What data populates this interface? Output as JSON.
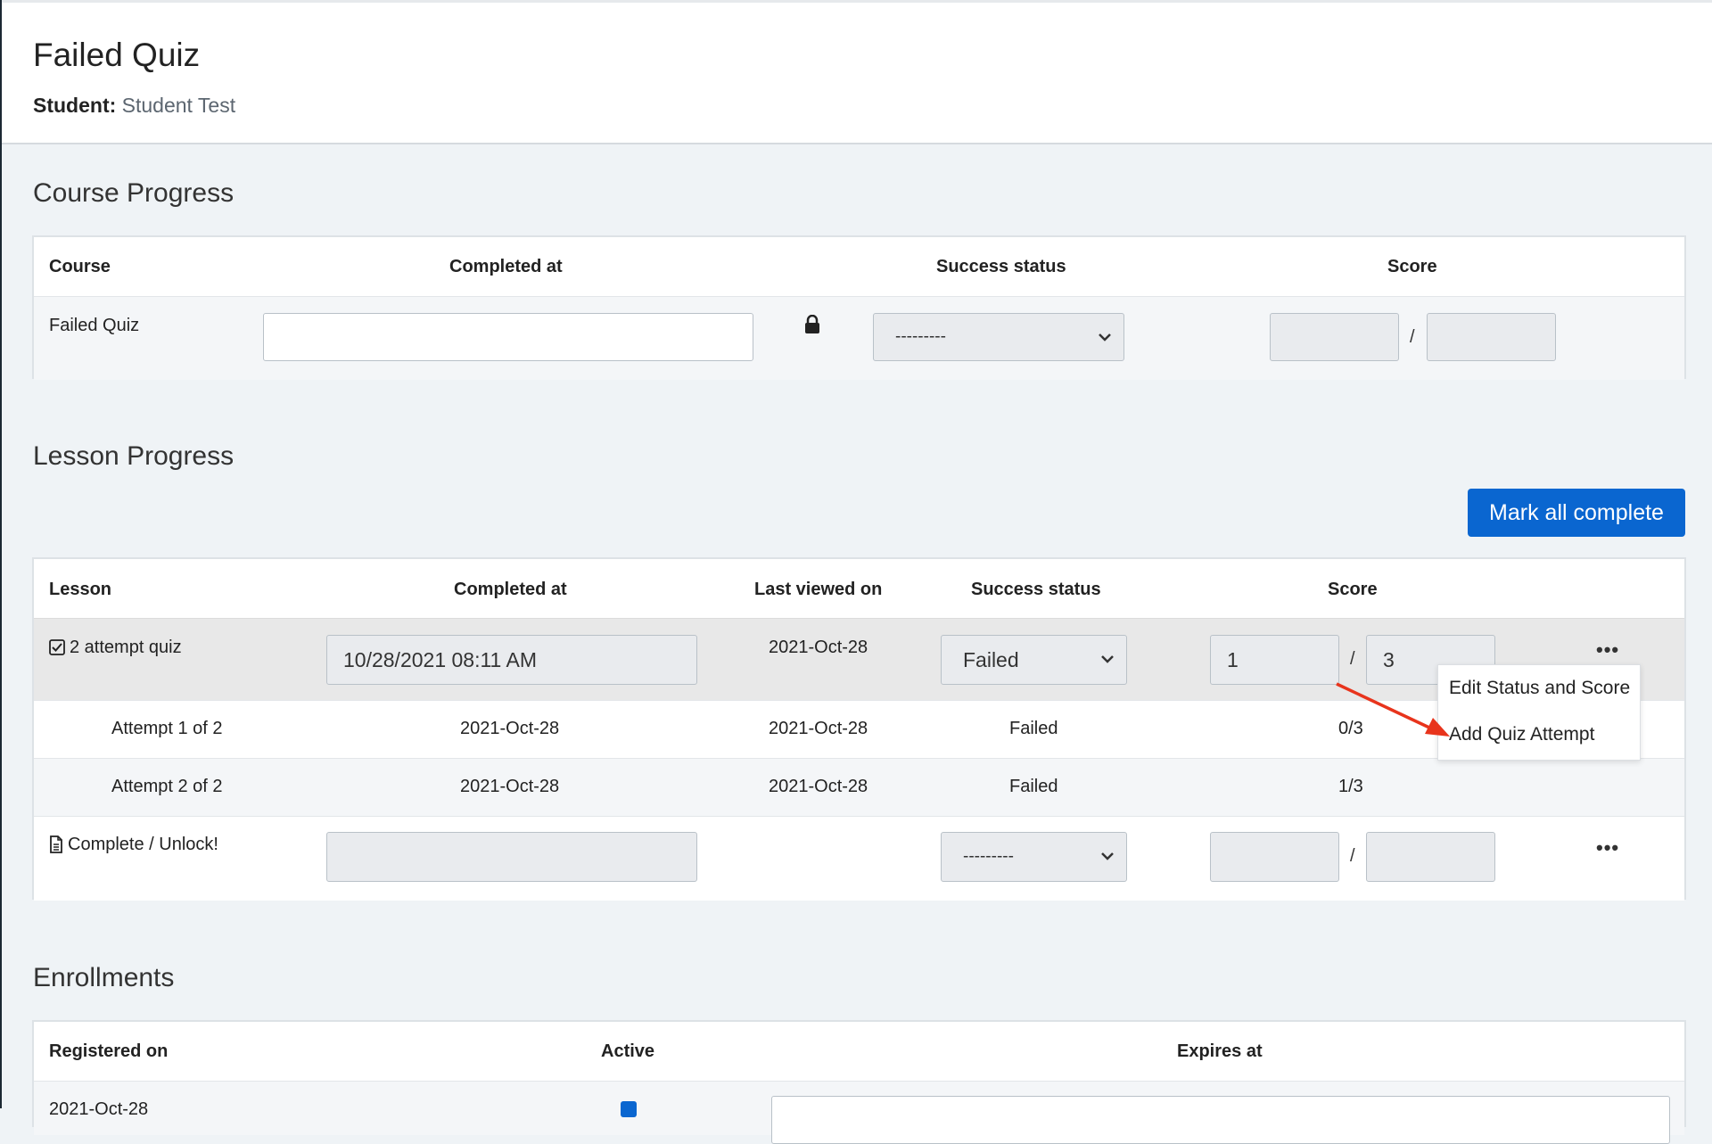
{
  "header": {
    "title": "Failed Quiz",
    "student_label": "Student:",
    "student_name": "Student Test"
  },
  "course_progress": {
    "title": "Course Progress",
    "columns": [
      "Course",
      "Completed at",
      "Success status",
      "Score"
    ],
    "row": {
      "course": "Failed Quiz",
      "completed_at": "",
      "status": "---------",
      "score": "",
      "max_score": "",
      "separator": "/"
    }
  },
  "lesson_progress": {
    "title": "Lesson Progress",
    "mark_all_label": "Mark all complete",
    "columns": [
      "Lesson",
      "Completed at",
      "Last viewed on",
      "Success status",
      "Score"
    ],
    "rows": [
      {
        "lesson": "2 attempt quiz",
        "completed_at": "10/28/2021 08:11 AM",
        "last_viewed": "2021-Oct-28",
        "status": "Failed",
        "score": "1",
        "max_score": "3",
        "separator": "/"
      },
      {
        "lesson": "Complete / Unlock!",
        "completed_at": "",
        "last_viewed": "",
        "status": "---------",
        "score": "",
        "max_score": "",
        "separator": "/"
      }
    ],
    "attempts": [
      {
        "label": "Attempt 1 of 2",
        "completed_at": "2021-Oct-28",
        "last_viewed": "2021-Oct-28",
        "status": "Failed",
        "score": "0/3"
      },
      {
        "label": "Attempt 2 of 2",
        "completed_at": "2021-Oct-28",
        "last_viewed": "2021-Oct-28",
        "status": "Failed",
        "score": "1/3"
      }
    ],
    "context_menu": [
      "Edit Status and Score",
      "Add Quiz Attempt"
    ],
    "more_label": "•••"
  },
  "enrollments": {
    "title": "Enrollments",
    "columns": [
      "Registered on",
      "Active",
      "Expires at"
    ],
    "row": {
      "registered_on": "2021-Oct-28",
      "active": true
    }
  },
  "colors": {
    "primary": "#0a66d0",
    "annotation_arrow": "#e8341c",
    "row_highlight": "#e8e8e8"
  }
}
